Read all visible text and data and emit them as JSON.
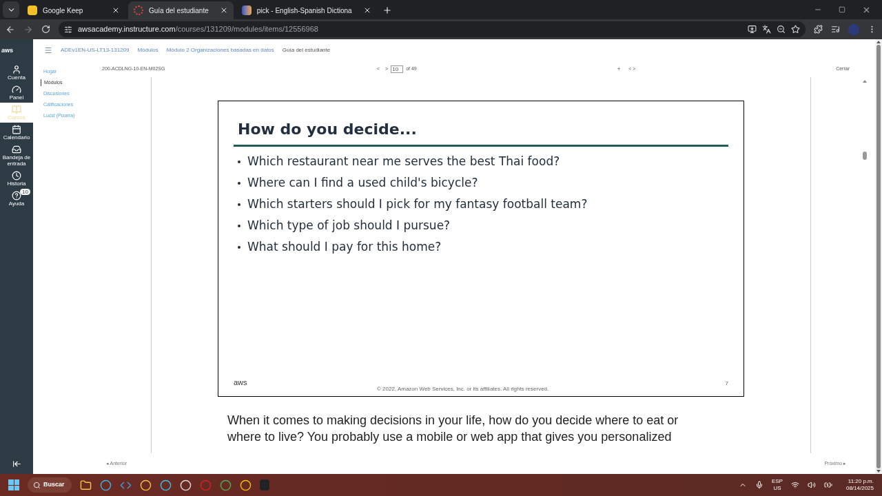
{
  "browser": {
    "tabs": [
      {
        "title": "Google Keep",
        "selected": false,
        "kind": "keep"
      },
      {
        "title": "Guía del estudiante",
        "selected": true,
        "kind": "canvas"
      },
      {
        "title": "pick - English-Spanish Dictiona",
        "selected": false,
        "kind": "dict"
      }
    ],
    "url_host": "awsacademy.instructure.com",
    "url_path": "/courses/131209/modules/items/12556968"
  },
  "brand": "aws",
  "global_nav": [
    {
      "label": "Cuenta",
      "selected": false,
      "kind": "account"
    },
    {
      "label": "Panel",
      "selected": false,
      "kind": "dashboard"
    },
    {
      "label": "Cursos",
      "selected": true,
      "kind": "courses"
    },
    {
      "label": "Calendario",
      "selected": false,
      "kind": "calendar"
    },
    {
      "label": "Bandeja de entrada",
      "selected": false,
      "kind": "inbox"
    },
    {
      "label": "Historia",
      "selected": false,
      "kind": "history"
    },
    {
      "label": "Ayuda",
      "selected": false,
      "kind": "help",
      "badge": "10"
    }
  ],
  "breadcrumbs": [
    "ADEv1EN-US-LT13-131209",
    "Módulos",
    "Módulo 2 Organizaciones basadas en datos",
    "Guía del estudiante"
  ],
  "course_nav": [
    {
      "label": "Hogar",
      "selected": false
    },
    {
      "label": "Módulos",
      "selected": true
    },
    {
      "label": "Discusiones",
      "selected": false
    },
    {
      "label": "Calificaciones",
      "selected": false
    },
    {
      "label": "Lucid (Pizarra)",
      "selected": false
    }
  ],
  "viewer": {
    "file": "200-ACDLNG-10-EN-M02SG",
    "prev": "<",
    "next": ">",
    "page": "10",
    "of": "of 49",
    "zoom_in": "+",
    "nav": "< >",
    "close": "Cerrar"
  },
  "slide": {
    "title": "How do you decide...",
    "bullets": [
      "Which restaurant near me serves the best Thai food?",
      "Where can I find a used child's bicycle?",
      "Which starters should I pick for my fantasy football team?",
      "Which type of job should I pursue?",
      "What should I pay for this home?"
    ],
    "logo": "aws",
    "copyright": "© 2022, Amazon Web Services, Inc. or its affiliates. All rights reserved.",
    "number": "7"
  },
  "notes": [
    "When it comes to making decisions in your life, how do you decide where to eat or",
    "where to live? You probably use a mobile or web app that gives you personalized"
  ],
  "footer": {
    "previous": "◂ Anterior",
    "next": "Próximo ▸"
  },
  "taskbar": {
    "search": "Buscar",
    "lang": "ESP",
    "region": "US",
    "time": "11:20 p.m.",
    "date": "08/14/2025"
  }
}
